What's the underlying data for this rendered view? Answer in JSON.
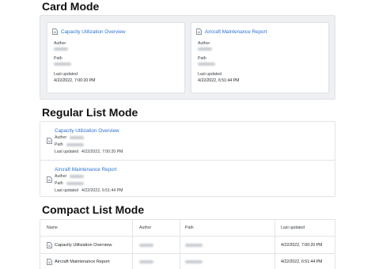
{
  "sections": {
    "card_mode": "Card Mode",
    "regular_list_mode": "Regular List Mode",
    "compact_list_mode": "Compact List Mode"
  },
  "fields": {
    "author": "Author",
    "path": "Path",
    "last_updated": "Last updated",
    "last_updated_inline": "Last updated"
  },
  "items": [
    {
      "title": "Capacity Utilization Overview",
      "date": "4/22/2022, 7:00:20 PM"
    },
    {
      "title": "Aircraft Maintenance Report",
      "date": "4/22/2022, 6:51:44 PM"
    }
  ],
  "table": {
    "headers": {
      "name": "Name",
      "author": "Author",
      "path": "Path",
      "last_updated": "Last updated"
    }
  },
  "icons": {
    "document": "document-icon"
  },
  "colors": {
    "link": "#2d72d2",
    "card_background": "#eef0f2"
  }
}
